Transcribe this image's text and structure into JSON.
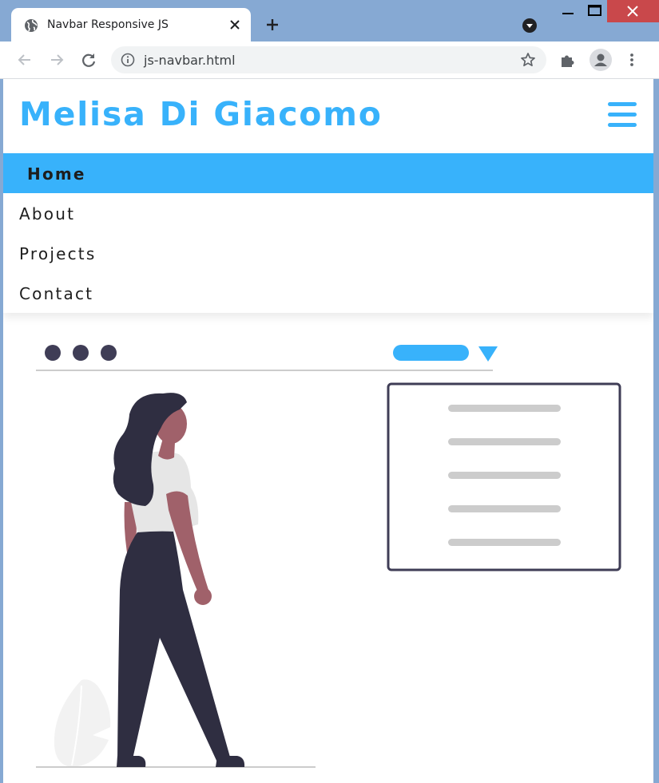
{
  "browser": {
    "tab_title": "Navbar Responsive JS",
    "url": "js-navbar.html",
    "icons": [
      "globe-icon",
      "close-icon",
      "plus-icon",
      "profile-download-icon",
      "minimize-icon",
      "maximize-icon",
      "window-close-icon",
      "back-icon",
      "forward-icon",
      "reload-icon",
      "info-icon",
      "star-icon",
      "extensions-icon",
      "account-icon",
      "more-icon"
    ],
    "colors": {
      "frame": "#86a9d3",
      "close_button": "#c9484b"
    }
  },
  "page": {
    "brand": "Melisa Di Giacomo",
    "menu_icon": "hamburger-icon",
    "nav": [
      {
        "label": "Home",
        "active": true
      },
      {
        "label": "About",
        "active": false
      },
      {
        "label": "Projects",
        "active": false
      },
      {
        "label": "Contact",
        "active": false
      }
    ],
    "colors": {
      "accent": "#38b2fb",
      "text": "#1d1d1d",
      "figure_dark": "#2f2e41",
      "skin": "#a0616a"
    }
  }
}
